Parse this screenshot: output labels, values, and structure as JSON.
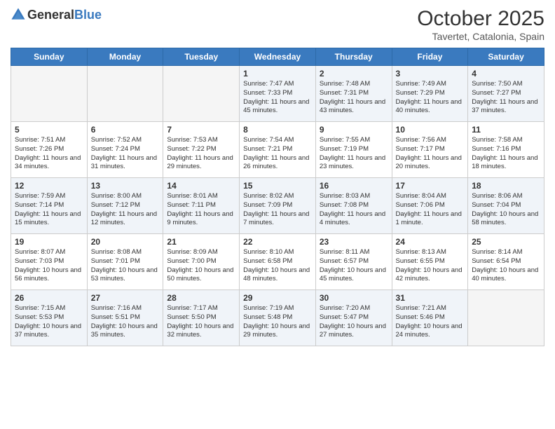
{
  "header": {
    "logo_general": "General",
    "logo_blue": "Blue",
    "month": "October 2025",
    "location": "Tavertet, Catalonia, Spain"
  },
  "days_of_week": [
    "Sunday",
    "Monday",
    "Tuesday",
    "Wednesday",
    "Thursday",
    "Friday",
    "Saturday"
  ],
  "weeks": [
    [
      {
        "day": "",
        "info": ""
      },
      {
        "day": "",
        "info": ""
      },
      {
        "day": "",
        "info": ""
      },
      {
        "day": "1",
        "info": "Sunrise: 7:47 AM\nSunset: 7:33 PM\nDaylight: 11 hours and 45 minutes."
      },
      {
        "day": "2",
        "info": "Sunrise: 7:48 AM\nSunset: 7:31 PM\nDaylight: 11 hours and 43 minutes."
      },
      {
        "day": "3",
        "info": "Sunrise: 7:49 AM\nSunset: 7:29 PM\nDaylight: 11 hours and 40 minutes."
      },
      {
        "day": "4",
        "info": "Sunrise: 7:50 AM\nSunset: 7:27 PM\nDaylight: 11 hours and 37 minutes."
      }
    ],
    [
      {
        "day": "5",
        "info": "Sunrise: 7:51 AM\nSunset: 7:26 PM\nDaylight: 11 hours and 34 minutes."
      },
      {
        "day": "6",
        "info": "Sunrise: 7:52 AM\nSunset: 7:24 PM\nDaylight: 11 hours and 31 minutes."
      },
      {
        "day": "7",
        "info": "Sunrise: 7:53 AM\nSunset: 7:22 PM\nDaylight: 11 hours and 29 minutes."
      },
      {
        "day": "8",
        "info": "Sunrise: 7:54 AM\nSunset: 7:21 PM\nDaylight: 11 hours and 26 minutes."
      },
      {
        "day": "9",
        "info": "Sunrise: 7:55 AM\nSunset: 7:19 PM\nDaylight: 11 hours and 23 minutes."
      },
      {
        "day": "10",
        "info": "Sunrise: 7:56 AM\nSunset: 7:17 PM\nDaylight: 11 hours and 20 minutes."
      },
      {
        "day": "11",
        "info": "Sunrise: 7:58 AM\nSunset: 7:16 PM\nDaylight: 11 hours and 18 minutes."
      }
    ],
    [
      {
        "day": "12",
        "info": "Sunrise: 7:59 AM\nSunset: 7:14 PM\nDaylight: 11 hours and 15 minutes."
      },
      {
        "day": "13",
        "info": "Sunrise: 8:00 AM\nSunset: 7:12 PM\nDaylight: 11 hours and 12 minutes."
      },
      {
        "day": "14",
        "info": "Sunrise: 8:01 AM\nSunset: 7:11 PM\nDaylight: 11 hours and 9 minutes."
      },
      {
        "day": "15",
        "info": "Sunrise: 8:02 AM\nSunset: 7:09 PM\nDaylight: 11 hours and 7 minutes."
      },
      {
        "day": "16",
        "info": "Sunrise: 8:03 AM\nSunset: 7:08 PM\nDaylight: 11 hours and 4 minutes."
      },
      {
        "day": "17",
        "info": "Sunrise: 8:04 AM\nSunset: 7:06 PM\nDaylight: 11 hours and 1 minute."
      },
      {
        "day": "18",
        "info": "Sunrise: 8:06 AM\nSunset: 7:04 PM\nDaylight: 10 hours and 58 minutes."
      }
    ],
    [
      {
        "day": "19",
        "info": "Sunrise: 8:07 AM\nSunset: 7:03 PM\nDaylight: 10 hours and 56 minutes."
      },
      {
        "day": "20",
        "info": "Sunrise: 8:08 AM\nSunset: 7:01 PM\nDaylight: 10 hours and 53 minutes."
      },
      {
        "day": "21",
        "info": "Sunrise: 8:09 AM\nSunset: 7:00 PM\nDaylight: 10 hours and 50 minutes."
      },
      {
        "day": "22",
        "info": "Sunrise: 8:10 AM\nSunset: 6:58 PM\nDaylight: 10 hours and 48 minutes."
      },
      {
        "day": "23",
        "info": "Sunrise: 8:11 AM\nSunset: 6:57 PM\nDaylight: 10 hours and 45 minutes."
      },
      {
        "day": "24",
        "info": "Sunrise: 8:13 AM\nSunset: 6:55 PM\nDaylight: 10 hours and 42 minutes."
      },
      {
        "day": "25",
        "info": "Sunrise: 8:14 AM\nSunset: 6:54 PM\nDaylight: 10 hours and 40 minutes."
      }
    ],
    [
      {
        "day": "26",
        "info": "Sunrise: 7:15 AM\nSunset: 5:53 PM\nDaylight: 10 hours and 37 minutes."
      },
      {
        "day": "27",
        "info": "Sunrise: 7:16 AM\nSunset: 5:51 PM\nDaylight: 10 hours and 35 minutes."
      },
      {
        "day": "28",
        "info": "Sunrise: 7:17 AM\nSunset: 5:50 PM\nDaylight: 10 hours and 32 minutes."
      },
      {
        "day": "29",
        "info": "Sunrise: 7:19 AM\nSunset: 5:48 PM\nDaylight: 10 hours and 29 minutes."
      },
      {
        "day": "30",
        "info": "Sunrise: 7:20 AM\nSunset: 5:47 PM\nDaylight: 10 hours and 27 minutes."
      },
      {
        "day": "31",
        "info": "Sunrise: 7:21 AM\nSunset: 5:46 PM\nDaylight: 10 hours and 24 minutes."
      },
      {
        "day": "",
        "info": ""
      }
    ]
  ]
}
